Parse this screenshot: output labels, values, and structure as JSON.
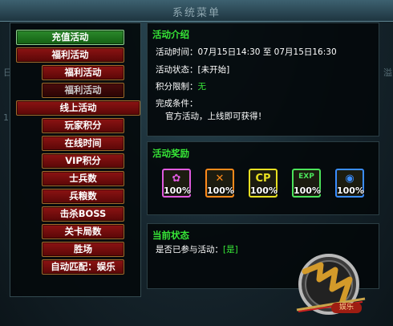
{
  "menu": {
    "items": [
      {
        "label": "充值活动",
        "style": "green"
      },
      {
        "label": "福利活动",
        "style": "red"
      },
      {
        "label": "福利活动",
        "style": "red"
      },
      {
        "label": "福利活动",
        "style": "dark"
      },
      {
        "label": "线上活动",
        "style": "red"
      },
      {
        "label": "玩家积分",
        "style": "red"
      },
      {
        "label": "在线时间",
        "style": "red"
      },
      {
        "label": "VIP积分",
        "style": "red"
      },
      {
        "label": "士兵数",
        "style": "red"
      },
      {
        "label": "兵粮数",
        "style": "red"
      },
      {
        "label": "击杀BOSS",
        "style": "red"
      },
      {
        "label": "关卡局数",
        "style": "red"
      },
      {
        "label": "胜场",
        "style": "red"
      },
      {
        "label": "自动匹配：娱乐",
        "style": "red"
      }
    ]
  },
  "intro": {
    "title": "活动介绍",
    "time_label": "活动时间：07月15日14:30 至 07月15日16:30",
    "status_label": "活动状态：[未开始]",
    "points_label": "积分限制：",
    "points_value": "无",
    "condition_label": "完成条件：",
    "condition_text": "官方活动，上线即可获得！"
  },
  "rewards": {
    "title": "活动奖励",
    "items": [
      {
        "icon": "pink-potion-icon",
        "pct": "100%",
        "glyph": "✿",
        "color": "#e05adf"
      },
      {
        "icon": "crossed-swords-icon",
        "pct": "100%",
        "glyph": "✕",
        "color": "#ff8a1a"
      },
      {
        "icon": "cp-badge-icon",
        "pct": "100%",
        "glyph": "CP",
        "color": "#e8e021"
      },
      {
        "icon": "exp-badge-icon",
        "pct": "100%",
        "glyph": "EXP",
        "color": "#4be35a"
      },
      {
        "icon": "blue-orb-icon",
        "pct": "100%",
        "glyph": "◉",
        "color": "#3a8dff"
      }
    ]
  },
  "status": {
    "title": "当前状态",
    "joined_label": "是否已参与活动：",
    "joined_value": "[是]"
  },
  "background": {
    "title": "系统菜单",
    "tag": "娱乐"
  }
}
